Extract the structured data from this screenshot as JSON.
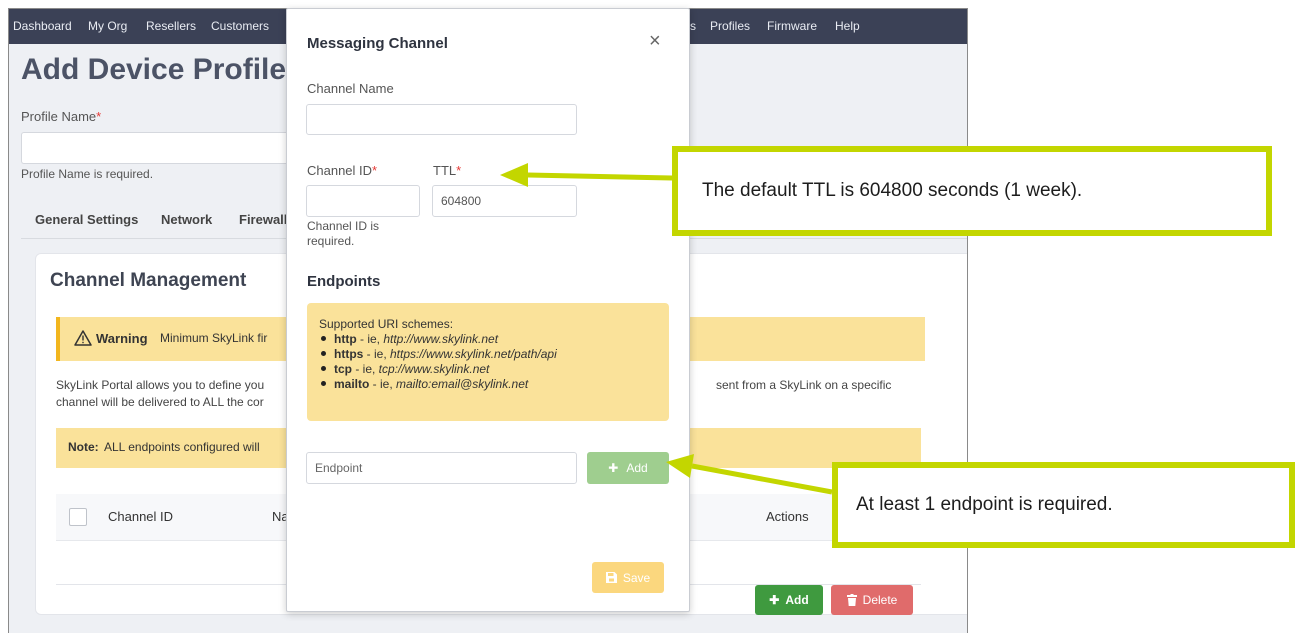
{
  "navbar": {
    "left_items": [
      "Dashboard",
      "My Org",
      "Resellers",
      "Customers"
    ],
    "right_items": [
      "s",
      "Profiles",
      "Firmware",
      "Help"
    ]
  },
  "page": {
    "title": "Add Device Profile",
    "profile_name_label": "Profile Name",
    "required_mark": "*",
    "profile_name_error": "Profile Name is required.",
    "tabs": [
      "General Settings",
      "Network",
      "Firewall"
    ]
  },
  "card": {
    "title": "Channel Management",
    "warning_label": "Warning",
    "warning_text": "Minimum SkyLink fir",
    "desc_line1_left": "SkyLink Portal allows you to define you",
    "desc_line1_right": "sent from a SkyLink on a specific",
    "desc_line2": "channel will be delivered to ALL the cor",
    "note_label": "Note:",
    "note_text": "ALL endpoints configured will",
    "columns": [
      "Channel ID",
      "Na",
      "Actions"
    ],
    "add_label": "Add",
    "delete_label": "Delete"
  },
  "modal": {
    "title": "Messaging Channel",
    "close_glyph": "×",
    "channel_name_label": "Channel Name",
    "channel_name_value": "",
    "channel_id_label": "Channel ID",
    "channel_id_value": "",
    "ttl_label": "TTL",
    "ttl_value": "604800",
    "channel_id_error": "Channel ID is required.",
    "endpoints_heading": "Endpoints",
    "uri_title": "Supported URI schemes:",
    "uri_schemes": [
      {
        "scheme": "http",
        "sep": " - ie, ",
        "example": "http://www.skylink.net"
      },
      {
        "scheme": "https",
        "sep": " - ie, ",
        "example": "https://www.skylink.net/path/api"
      },
      {
        "scheme": "tcp",
        "sep": " - ie, ",
        "example": "tcp://www.skylink.net"
      },
      {
        "scheme": "mailto",
        "sep": " - ie, ",
        "example": "mailto:email@skylink.net"
      }
    ],
    "endpoint_placeholder": "Endpoint",
    "add_label": "Add",
    "save_label": "Save"
  },
  "callouts": {
    "ttl_note": "The default TTL is 604800 seconds (1 week).",
    "endpoint_note": "At least 1 endpoint is required."
  },
  "colors": {
    "navbar": "#3b4156",
    "callout_border": "#c3d600",
    "warning_bg": "#fae29a",
    "add_green": "#3f9a3f",
    "delete_red": "#e06b6b"
  }
}
